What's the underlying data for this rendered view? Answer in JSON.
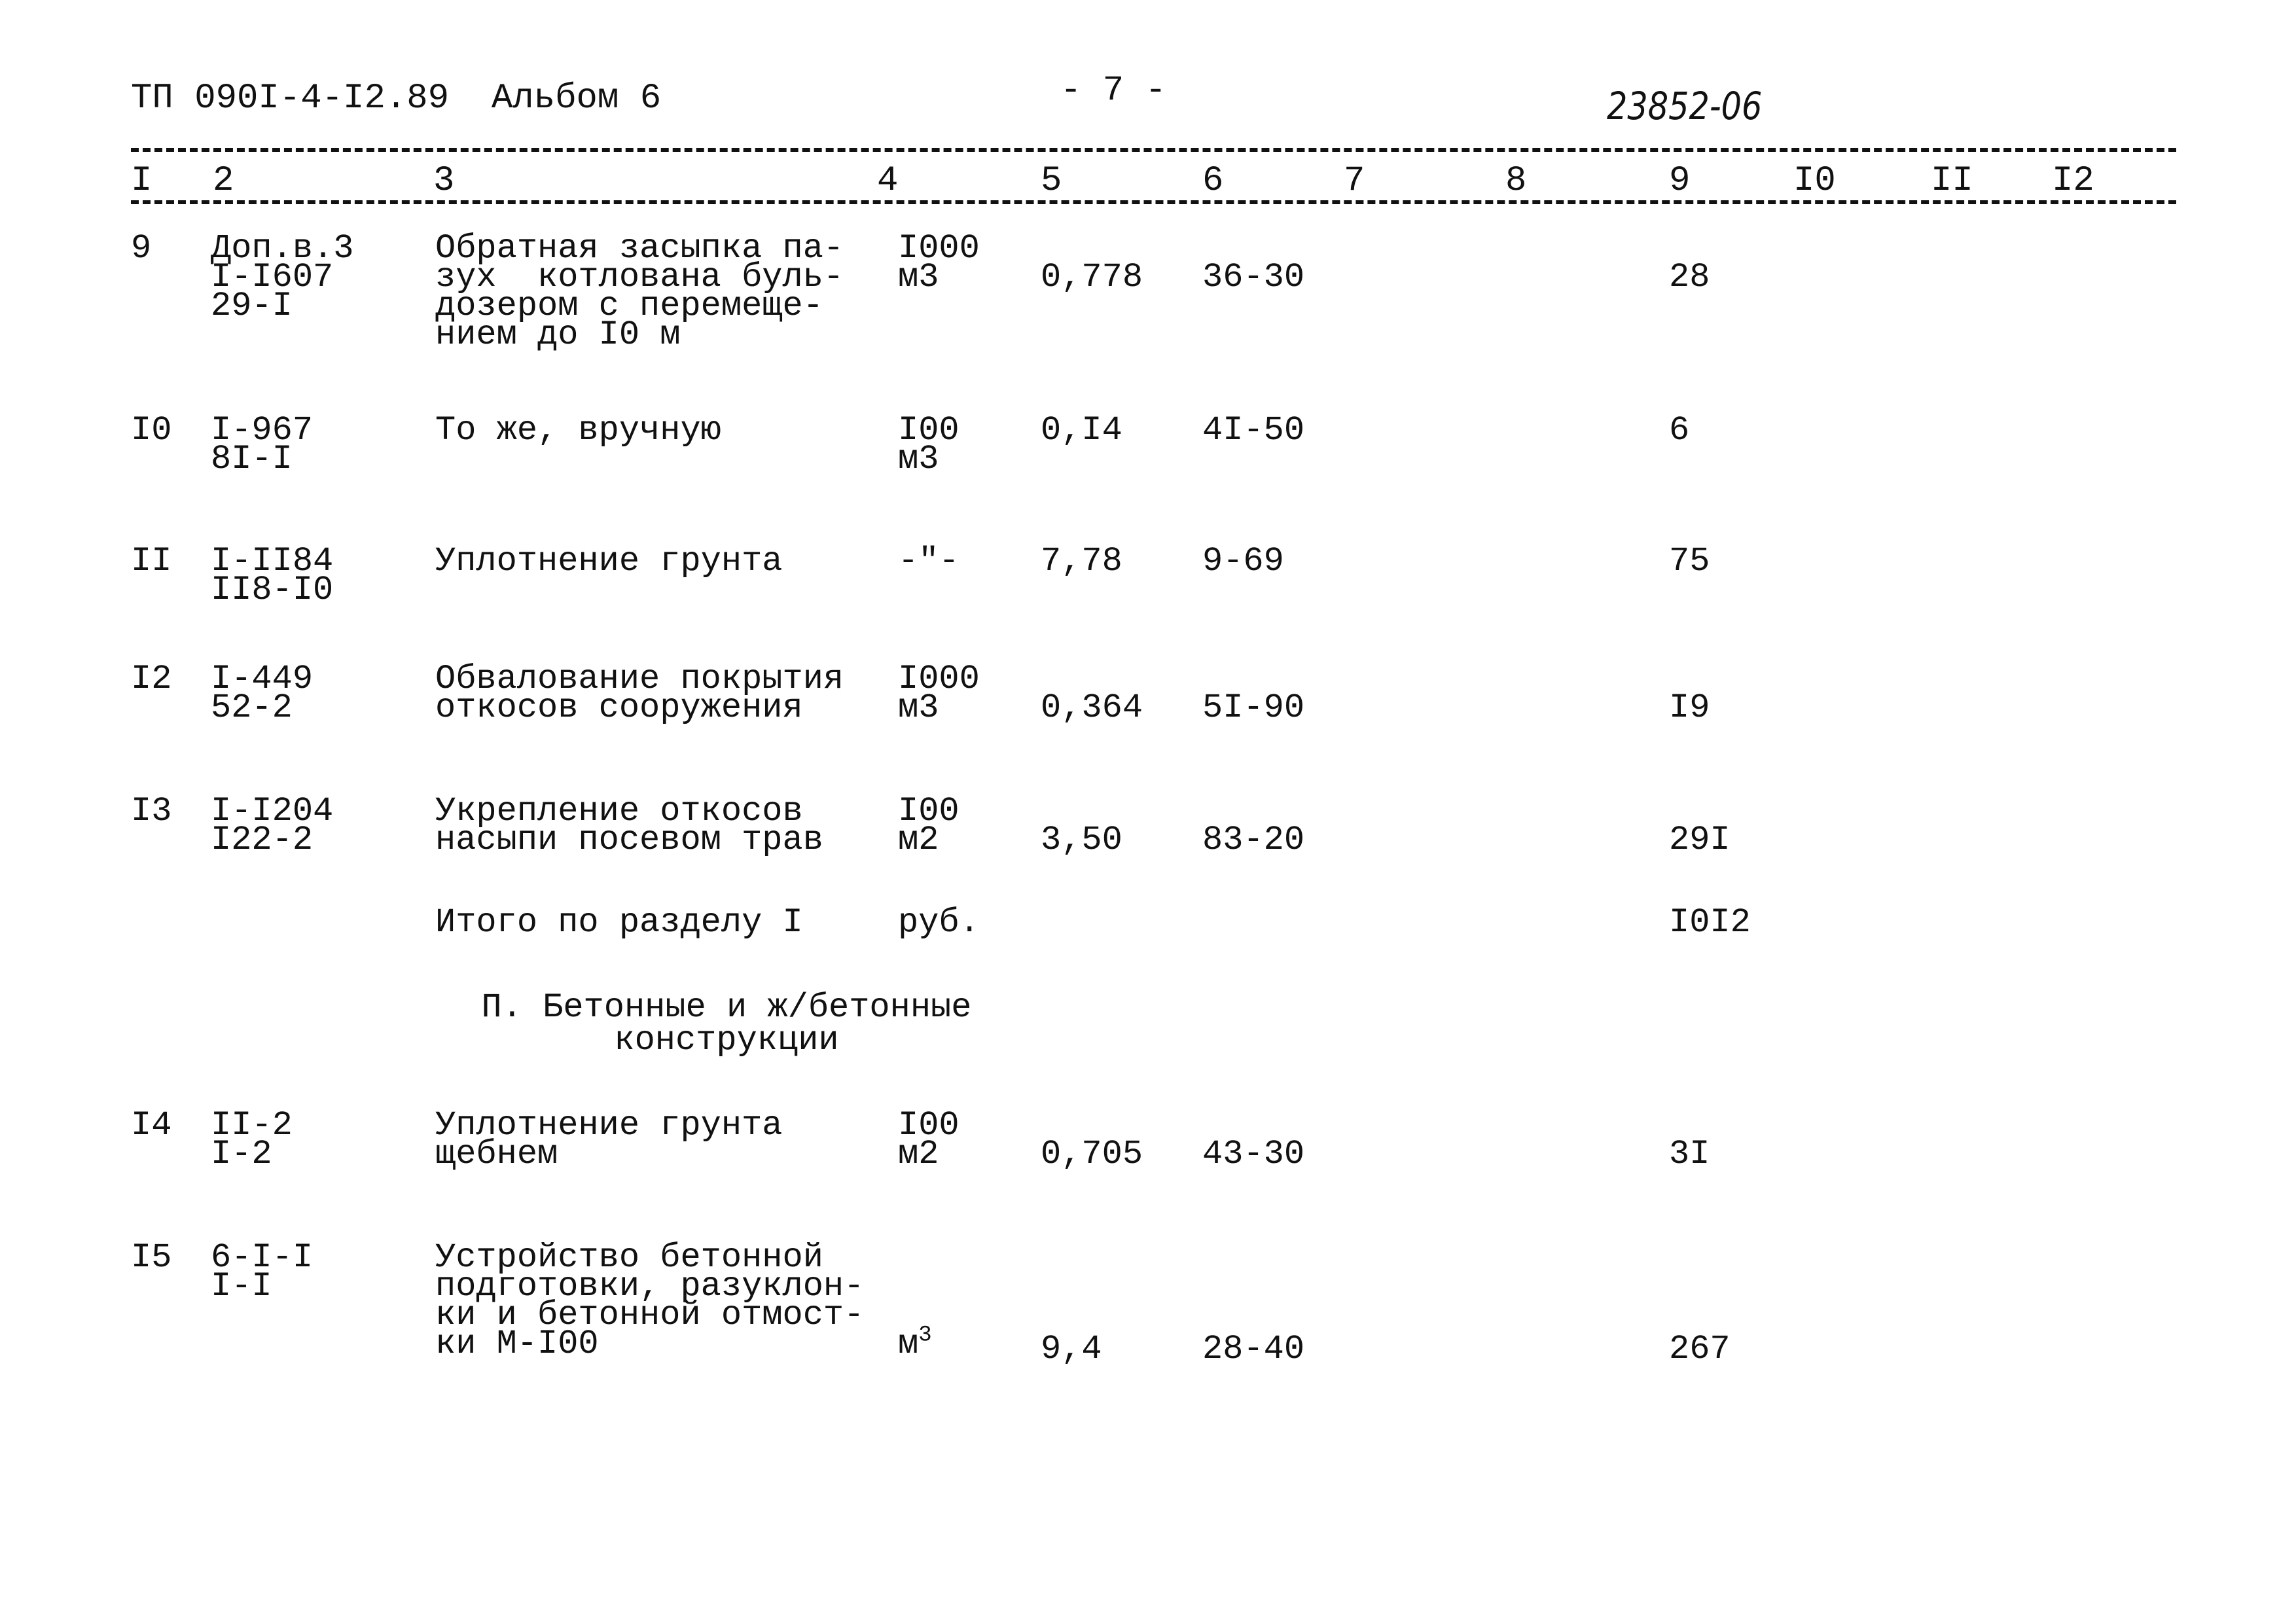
{
  "header": {
    "title": "ТП 090I-4-I2.89  Альбом 6",
    "page_number": "- 7 -",
    "doc_code": "23852-06"
  },
  "columns": [
    "I",
    "2",
    "3",
    "4",
    "5",
    "6",
    "7",
    "8",
    "9",
    "I0",
    "II",
    "I2"
  ],
  "rows": [
    {
      "num": "9",
      "code": "Доп.в.3\nI-I607\n29-I",
      "description": "Обратная засыпка па-\nзух  котлована буль-\nдозером с перемеще-\nнием до I0 м",
      "unit": "I000\nм3",
      "quantity": "0,778",
      "unit_price": "36-30",
      "total": "28"
    },
    {
      "num": "I0",
      "code": "I-967\n8I-I",
      "description": "То же, вручную",
      "unit": "I00\nм3",
      "quantity": "0,I4",
      "unit_price": "4I-50",
      "total": "6"
    },
    {
      "num": "II",
      "code": "I-II84\nII8-I0",
      "description": "Уплотнение грунта",
      "unit": "-\"-",
      "quantity": "7,78",
      "unit_price": "9-69",
      "total": "75"
    },
    {
      "num": "I2",
      "code": "I-449\n52-2",
      "description": "Обвалование покрытия\nоткосов сооружения",
      "unit": "I000\nм3",
      "quantity": "0,364",
      "unit_price": "5I-90",
      "total": "I9"
    },
    {
      "num": "I3",
      "code": "I-I204\nI22-2",
      "description": "Укрепление откосов\nнасыпи посевом трав",
      "unit": "I00\nм2",
      "quantity": "3,50",
      "unit_price": "83-20",
      "total": "29I"
    },
    {
      "num": "I4",
      "code": "II-2\nI-2",
      "description": "Уплотнение грунта\nщебнем",
      "unit": "I00\nм2",
      "quantity": "0,705",
      "unit_price": "43-30",
      "total": "3I"
    },
    {
      "num": "I5",
      "code": "6-I-I\nI-I",
      "description": "Устройство бетонной\nподготовки, разуклон-\nки и бетонной отмост-\nки М-I00",
      "unit_base": "м",
      "unit_sup": "3",
      "quantity": "9,4",
      "unit_price": "28-40",
      "total": "267"
    }
  ],
  "section_total": {
    "label": "Итого по разделу I",
    "unit": "руб.",
    "total": "I0I2"
  },
  "section_heading": "П. Бетонные и ж/бетонные\nконструкции"
}
